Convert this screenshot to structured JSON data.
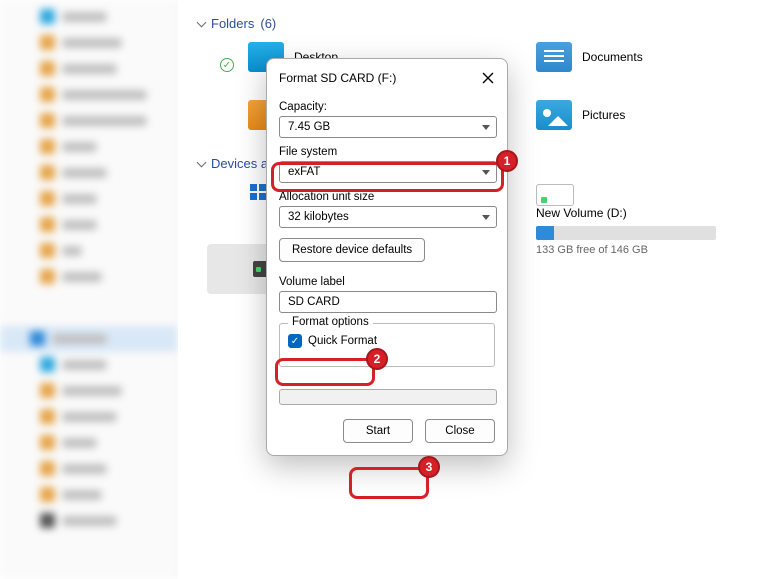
{
  "sections": {
    "folders_label": "Folders",
    "folders_count": "(6)",
    "devices_label": "Devices and drives"
  },
  "folders": {
    "desktop": "Desktop",
    "documents": "Documents",
    "pictures": "Pictures"
  },
  "drives": {
    "nv_name": "New Volume (D:)",
    "nv_free": "133 GB free of 146 GB",
    "nv_fill_percent": 10
  },
  "dialog": {
    "title": "Format SD CARD (F:)",
    "capacity_label": "Capacity:",
    "capacity_value": "7.45 GB",
    "fs_label": "File system",
    "fs_value": "exFAT",
    "alloc_label": "Allocation unit size",
    "alloc_value": "32 kilobytes",
    "restore_label": "Restore device defaults",
    "volume_label_label": "Volume label",
    "volume_label_value": "SD CARD",
    "format_options_legend": "Format options",
    "quick_format_label": "Quick Format",
    "quick_format_checked": true,
    "start_label": "Start",
    "close_label": "Close"
  },
  "callouts": {
    "one": "1",
    "two": "2",
    "three": "3"
  }
}
